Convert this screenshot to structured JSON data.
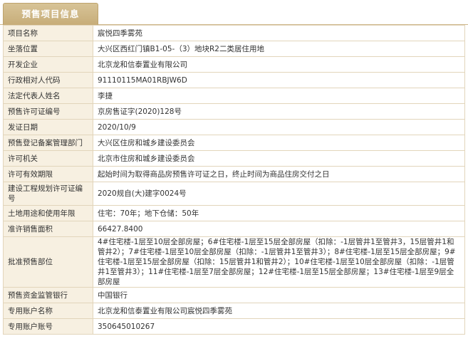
{
  "tab": {
    "label": "预售项目信息"
  },
  "rows": [
    {
      "key": "项目名称",
      "value": "宸悦四季雾苑"
    },
    {
      "key": "坐落位置",
      "value": "大兴区西红门镇B1-05-（3）地块R2二类居住用地"
    },
    {
      "key": "开发企业",
      "value": "北京龙和信泰置业有限公司"
    },
    {
      "key": "行政相对人代码",
      "value": "91110115MA01RBJW6D"
    },
    {
      "key": "法定代表人姓名",
      "value": "李捷"
    },
    {
      "key": "预售许可证编号",
      "value": "京房售证字(2020)128号"
    },
    {
      "key": "发证日期",
      "value": "2020/10/9"
    },
    {
      "key": "预售登记备案管理部门",
      "value": "大兴区住房和城乡建设委员会"
    },
    {
      "key": "许可机关",
      "value": "北京市住房和城乡建设委员会"
    },
    {
      "key": "许可有效期限",
      "value": "起始时间为取得商品房预售许可证之日，终止时间为商品住房交付之日"
    },
    {
      "key": "建设工程规划许可证编号",
      "value": "2020规自(大)建字0024号"
    },
    {
      "key": "土地用途和使用年限",
      "value": "住宅：70年；地下仓储：50年"
    },
    {
      "key": "准许销售面积",
      "value": "66427.8400"
    },
    {
      "key": "批准预售部位",
      "value": "4#住宅楼-1层至10层全部房屋；6#住宅楼-1层至15层全部房屋（扣除：-1层管井1至管井3，15层管井1和管井2）；7#住宅楼-1层至10层全部房屋（扣除：-1层管井1至管井3）；8#住宅楼-1层至15层全部房屋；9#住宅楼-1层至15层全部房屋（扣除：15层管井1和管井2）；10#住宅楼-1层至10层全部房屋（扣除：-1层管井1至管井3）；11#住宅楼-1层至7层全部房屋；12#住宅楼-1层至15层全部房屋；13#住宅楼-1层至9层全部房屋"
    },
    {
      "key": "预售资金监管银行",
      "value": "中国银行"
    },
    {
      "key": "专用账户名称",
      "value": "北京龙和信泰置业有限公司宸悦四季雾苑"
    },
    {
      "key": "专用账户账号",
      "value": "350645010267"
    }
  ]
}
